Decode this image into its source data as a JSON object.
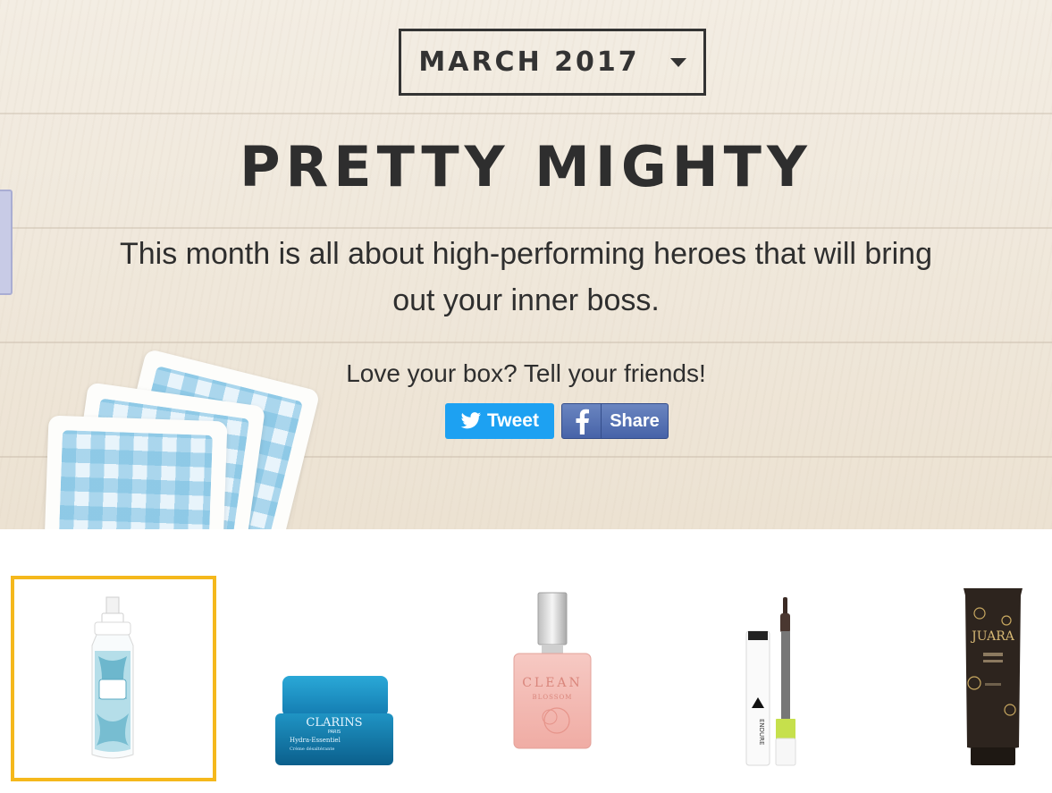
{
  "header": {
    "month_select": {
      "selected": "MARCH 2017"
    },
    "title": "PRETTY MIGHTY",
    "description": "This month is all about high-performing heroes that will bring out your inner boss.",
    "share_prompt": "Love your box? Tell your friends!",
    "tweet_label": "Tweet",
    "share_label": "Share"
  },
  "products": [
    {
      "name": "product-spray-bottle",
      "brand": "",
      "selected": true
    },
    {
      "name": "product-clarins-cream",
      "brand": "CLARINS",
      "brand_sub": "PARIS",
      "line": "Hydra-Essentiel",
      "line_sub": "Crème désaltérante",
      "selected": false
    },
    {
      "name": "product-clean-perfume",
      "brand": "CLEAN",
      "line": "BLOSSOM",
      "selected": false
    },
    {
      "name": "product-mascara",
      "brand": "ENDURE",
      "selected": false
    },
    {
      "name": "product-juara-balm",
      "brand": "JUARA",
      "line": "COCONUT CLOVE HAND & NAIL BALM",
      "selected": false
    }
  ],
  "colors": {
    "accent_selected": "#f5b81c",
    "twitter": "#1da1f2",
    "facebook": "#4763a8",
    "text": "#2e2e2e"
  }
}
